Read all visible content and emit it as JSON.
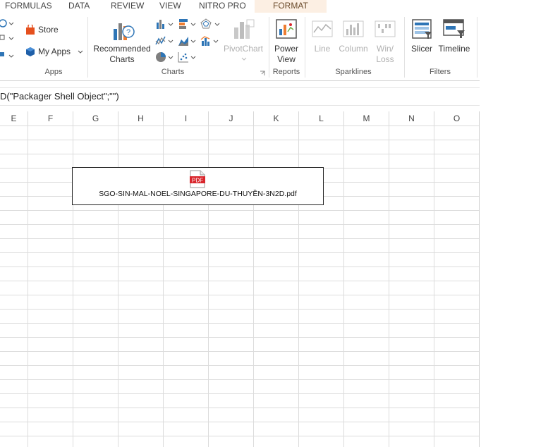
{
  "tabs": [
    {
      "label": "FORMULAS"
    },
    {
      "label": "DATA"
    },
    {
      "label": "REVIEW"
    },
    {
      "label": "VIEW"
    },
    {
      "label": "NITRO PRO"
    },
    {
      "label": "FORMAT"
    }
  ],
  "ribbon": {
    "apps": {
      "store_label": "Store",
      "myapps_label": "My Apps",
      "group_label": "Apps"
    },
    "charts": {
      "recommended_line1": "Recommended",
      "recommended_line2": "Charts",
      "pivotchart_label": "PivotChart",
      "group_label": "Charts"
    },
    "reports": {
      "powerview_line1": "Power",
      "powerview_line2": "View",
      "group_label": "Reports"
    },
    "sparklines": {
      "line_label": "Line",
      "column_label": "Column",
      "winloss_line1": "Win/",
      "winloss_line2": "Loss",
      "group_label": "Sparklines"
    },
    "filters": {
      "slicer_label": "Slicer",
      "timeline_label": "Timeline",
      "group_label": "Filters"
    }
  },
  "formula_bar": {
    "text": "D(\"Packager Shell Object\";\"\")"
  },
  "columns": [
    "E",
    "F",
    "G",
    "H",
    "I",
    "J",
    "K",
    "L",
    "M",
    "N",
    "O"
  ],
  "embedded_object": {
    "file_name": "SGO-SIN-MAL-NOEL-SINGAPORE-DU-THUYỀN-3N2D.pdf",
    "icon_text": "PDF"
  },
  "colors": {
    "pdf_red": "#d9262c",
    "format_tab_bg": "#fcefe3"
  }
}
